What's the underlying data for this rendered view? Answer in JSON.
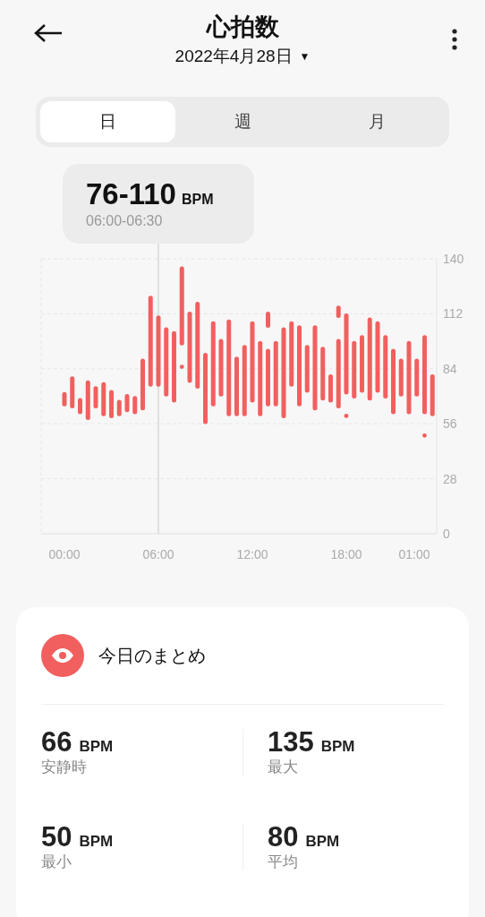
{
  "header": {
    "title": "心拍数",
    "date": "2022年4月28日",
    "date_caret": "▼"
  },
  "tabs": [
    {
      "label": "日",
      "selected": true
    },
    {
      "label": "週",
      "selected": false
    },
    {
      "label": "月",
      "selected": false
    }
  ],
  "tooltip": {
    "value": "76-110",
    "unit": "BPM",
    "range": "06:00-06:30"
  },
  "chart": {
    "y_labels": [
      "140",
      "112",
      "84",
      "56",
      "28",
      "0"
    ],
    "x_labels": [
      "00:00",
      "06:00",
      "12:00",
      "18:00",
      "01:00"
    ]
  },
  "summary": {
    "title": "今日のまとめ",
    "stats": [
      {
        "value": "66",
        "unit": "BPM",
        "label": "安静時"
      },
      {
        "value": "135",
        "unit": "BPM",
        "label": "最大"
      },
      {
        "value": "50",
        "unit": "BPM",
        "label": "最小"
      },
      {
        "value": "80",
        "unit": "BPM",
        "label": "平均"
      }
    ]
  }
}
